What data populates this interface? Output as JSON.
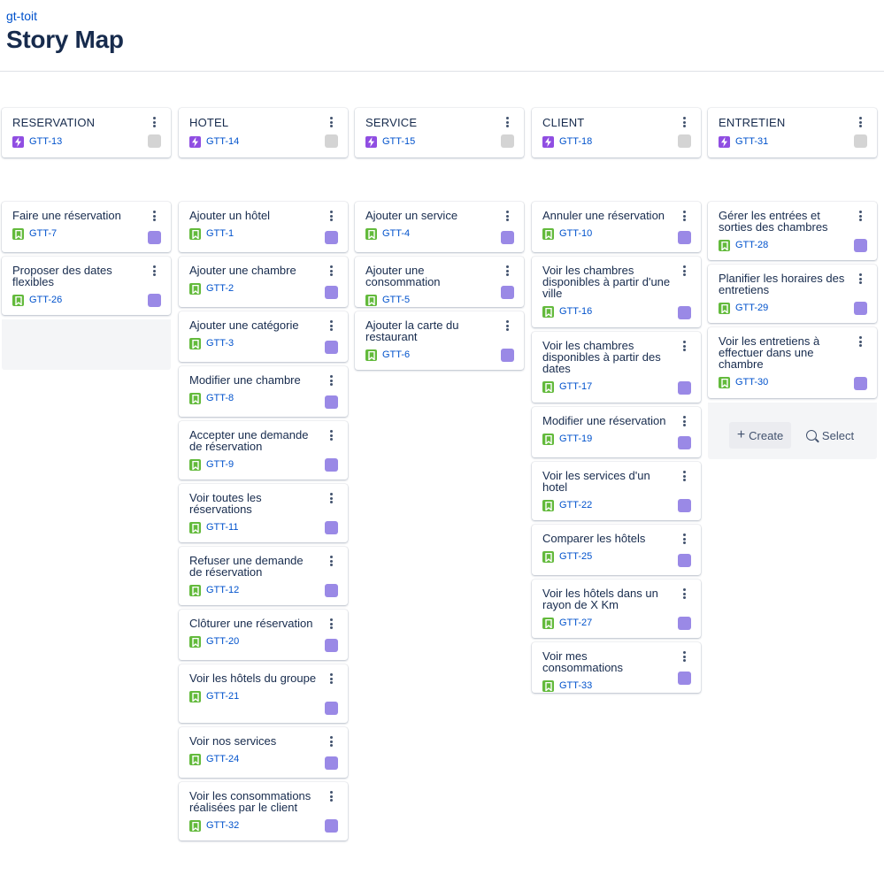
{
  "header": {
    "project": "gt-toit",
    "title": "Story Map"
  },
  "colors": {
    "epic_icon": "#904ee2",
    "story_icon": "#63ba3c",
    "status_todo": "#d4d4d4",
    "status_purple": "#9a89e6",
    "link": "#0052cc"
  },
  "actions": {
    "create_label": "Create",
    "select_label": "Select"
  },
  "epics": [
    {
      "title": "RESERVATION",
      "key": "GTT-13",
      "stories": [
        {
          "title": "Faire une réservation",
          "key": "GTT-7"
        },
        {
          "title": "Proposer des dates flexibles",
          "key": "GTT-26"
        }
      ]
    },
    {
      "title": "HOTEL",
      "key": "GTT-14",
      "stories": [
        {
          "title": "Ajouter un hôtel",
          "key": "GTT-1"
        },
        {
          "title": "Ajouter une chambre",
          "key": "GTT-2"
        },
        {
          "title": "Ajouter une catégorie",
          "key": "GTT-3"
        },
        {
          "title": "Modifier une chambre",
          "key": "GTT-8"
        },
        {
          "title": "Accepter une demande de réservation",
          "key": "GTT-9"
        },
        {
          "title": "Voir toutes les réservations",
          "key": "GTT-11"
        },
        {
          "title": "Refuser une demande de réservation",
          "key": "GTT-12"
        },
        {
          "title": "Clôturer une réservation",
          "key": "GTT-20"
        },
        {
          "title": "Voir les hôtels du groupe",
          "key": "GTT-21"
        },
        {
          "title": "Voir nos services",
          "key": "GTT-24"
        },
        {
          "title": "Voir les consommations réalisées par le client",
          "key": "GTT-32"
        }
      ]
    },
    {
      "title": "SERVICE",
      "key": "GTT-15",
      "stories": [
        {
          "title": "Ajouter un service",
          "key": "GTT-4"
        },
        {
          "title": "Ajouter une consommation",
          "key": "GTT-5"
        },
        {
          "title": "Ajouter la carte du restaurant",
          "key": "GTT-6"
        }
      ]
    },
    {
      "title": "CLIENT",
      "key": "GTT-18",
      "stories": [
        {
          "title": "Annuler une réservation",
          "key": "GTT-10"
        },
        {
          "title": "Voir les chambres disponibles à partir d'une ville",
          "key": "GTT-16"
        },
        {
          "title": "Voir les chambres disponibles à partir des dates",
          "key": "GTT-17"
        },
        {
          "title": "Modifier une réservation",
          "key": "GTT-19"
        },
        {
          "title": "Voir les services d'un hotel",
          "key": "GTT-22"
        },
        {
          "title": "Comparer les hôtels",
          "key": "GTT-25"
        },
        {
          "title": "Voir les hôtels dans un rayon de X Km",
          "key": "GTT-27"
        },
        {
          "title": "Voir mes consommations",
          "key": "GTT-33"
        }
      ]
    },
    {
      "title": "ENTRETIEN",
      "key": "GTT-31",
      "stories": [
        {
          "title": "Gérer les entrées et sorties des chambres",
          "key": "GTT-28"
        },
        {
          "title": "Planifier les horaires des entretiens",
          "key": "GTT-29"
        },
        {
          "title": "Voir les entretiens à effectuer dans une chambre",
          "key": "GTT-30"
        }
      ]
    }
  ]
}
